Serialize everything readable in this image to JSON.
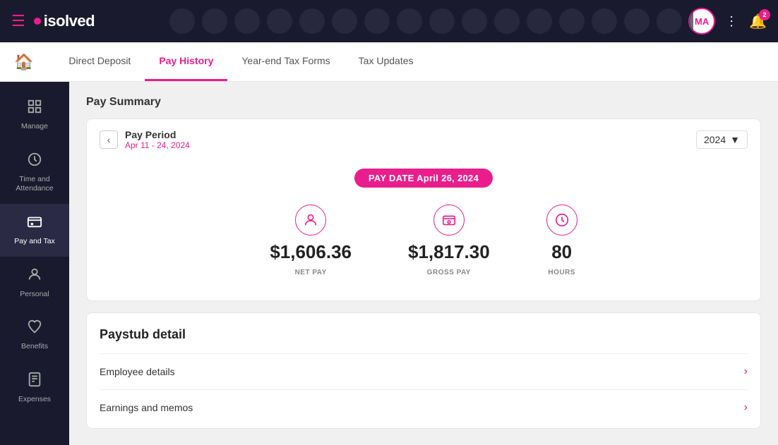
{
  "topnav": {
    "logo_text": "isolved",
    "avatar_initials": "MA",
    "bell_badge": "2"
  },
  "secondnav": {
    "tabs": [
      {
        "id": "direct-deposit",
        "label": "Direct Deposit",
        "active": false
      },
      {
        "id": "pay-history",
        "label": "Pay History",
        "active": true
      },
      {
        "id": "year-end-tax",
        "label": "Year-end Tax Forms",
        "active": false
      },
      {
        "id": "tax-updates",
        "label": "Tax Updates",
        "active": false
      }
    ]
  },
  "sidebar": {
    "items": [
      {
        "id": "manage",
        "label": "Manage",
        "icon": "🗂"
      },
      {
        "id": "time-attendance",
        "label": "Time and\nAttendance",
        "icon": "⏱"
      },
      {
        "id": "pay-tax",
        "label": "Pay and Tax",
        "icon": "💳",
        "active": true
      },
      {
        "id": "personal",
        "label": "Personal",
        "icon": "👤"
      },
      {
        "id": "benefits",
        "label": "Benefits",
        "icon": "❤"
      },
      {
        "id": "expenses",
        "label": "Expenses",
        "icon": "📋"
      }
    ]
  },
  "main": {
    "pay_summary_title": "Pay Summary",
    "pay_period": {
      "label": "Pay Period",
      "date_range": "Apr 11 - 24, 2024",
      "year": "2024"
    },
    "pay_date_label": "PAY DATE",
    "pay_date_value": "April 26, 2024",
    "stats": [
      {
        "id": "net-pay",
        "value": "$1,606.36",
        "label": "NET PAY",
        "icon": "person"
      },
      {
        "id": "gross-pay",
        "value": "$1,817.30",
        "label": "GROSS PAY",
        "icon": "money"
      },
      {
        "id": "hours",
        "value": "80",
        "label": "HOURS",
        "icon": "clock"
      }
    ],
    "paystub_title": "Paystub detail",
    "detail_rows": [
      {
        "label": "Employee details"
      },
      {
        "label": "Earnings and memos"
      }
    ]
  }
}
